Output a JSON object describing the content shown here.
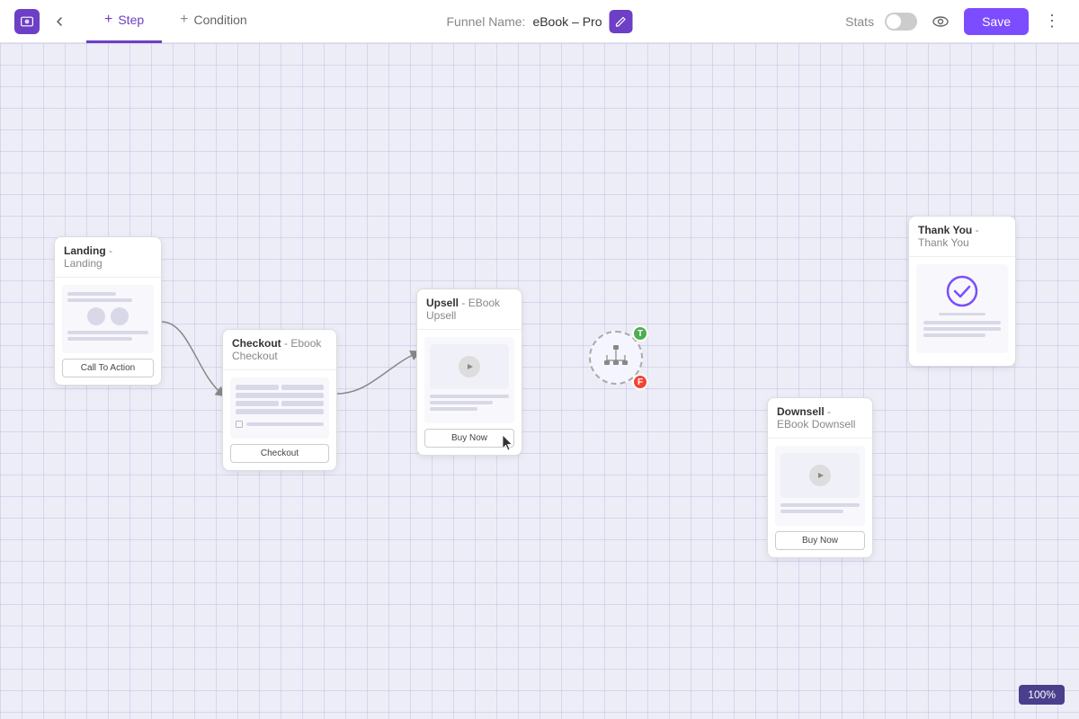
{
  "header": {
    "tabs": [
      {
        "id": "step",
        "label": "Step",
        "active": true,
        "icon": "plus"
      },
      {
        "id": "condition",
        "label": "Condition",
        "active": false,
        "icon": "plus"
      }
    ],
    "funnel_name_label": "Funnel Name:",
    "funnel_name": "eBook – Pro",
    "stats_label": "Stats",
    "save_label": "Save"
  },
  "canvas": {
    "zoom": "100%"
  },
  "cards": {
    "landing": {
      "title": "Landing",
      "subtitle": "- Landing",
      "cta_label": "Call To Action"
    },
    "checkout": {
      "title": "Checkout",
      "subtitle": "- Ebook Checkout",
      "cta_label": "Checkout"
    },
    "upsell": {
      "title": "Upsell",
      "subtitle": "- EBook Upsell",
      "cta_label": "Buy Now"
    },
    "thankyou": {
      "title": "Thank You",
      "subtitle": "- Thank You"
    },
    "downsell": {
      "title": "Downsell",
      "subtitle": "- EBook Downsell",
      "cta_label": "Buy Now"
    }
  },
  "condition": {
    "true_label": "T",
    "false_label": "F"
  }
}
